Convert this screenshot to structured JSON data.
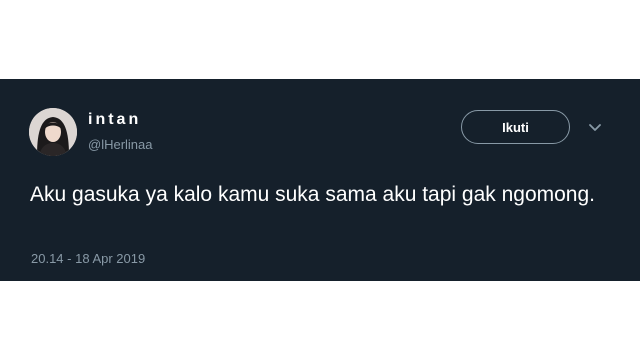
{
  "tweet": {
    "author": {
      "display_name": "intan",
      "handle": "@lHerlinaa",
      "avatar": "profile-photo"
    },
    "follow_button_label": "Ikuti",
    "menu_icon": "chevron-down-icon",
    "text": "Aku gasuka ya kalo kamu suka sama aku tapi gak ngomong.",
    "timestamp": "20.14 - 18 Apr 2019"
  },
  "colors": {
    "card_background": "#15202b",
    "page_background": "#ffffff",
    "text_primary": "#ffffff",
    "text_secondary": "#8899a6"
  }
}
